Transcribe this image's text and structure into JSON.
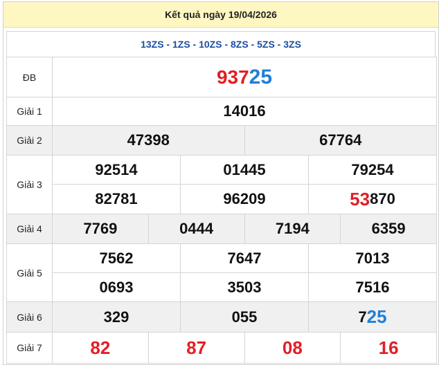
{
  "header": {
    "title": "Kết quả ngày 19/04/2026"
  },
  "codes": "13ZS - 1ZS - 10ZS - 8ZS - 5ZS - 3ZS",
  "prizes": {
    "db": {
      "label": "ĐB",
      "prefix": "937",
      "suffix": "25"
    },
    "g1": {
      "label": "Giải 1",
      "values": [
        "14016"
      ]
    },
    "g2": {
      "label": "Giải 2",
      "values": [
        "47398",
        "67764"
      ]
    },
    "g3": {
      "label": "Giải 3",
      "row1": [
        "92514",
        "01445",
        "79254"
      ],
      "row2": [
        "82781",
        "96209"
      ],
      "row2_last": {
        "prefix": "53",
        "suffix": "870"
      }
    },
    "g4": {
      "label": "Giải 4",
      "values": [
        "7769",
        "0444",
        "7194",
        "6359"
      ]
    },
    "g5": {
      "label": "Giải 5",
      "row1": [
        "7562",
        "7647",
        "7013"
      ],
      "row2": [
        "0693",
        "3503",
        "7516"
      ]
    },
    "g6": {
      "label": "Giải 6",
      "values": [
        "329",
        "055"
      ],
      "last": {
        "prefix": "7",
        "suffix": "25"
      }
    },
    "g7": {
      "label": "Giải 7",
      "values": [
        "82",
        "87",
        "08",
        "16"
      ]
    }
  },
  "colors": {
    "header_bg": "#fff7c2",
    "red": "#e31e24",
    "blue": "#1f7fd8",
    "code_blue": "#1a4da1",
    "row_gray": "#f0f0f0"
  }
}
